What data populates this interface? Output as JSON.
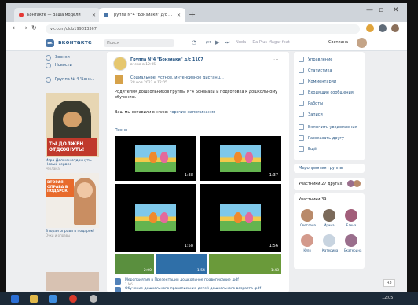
{
  "browser": {
    "tabs": [
      {
        "title": "Контакте — Ваша модели",
        "active": false,
        "favicon_color": "#e53935"
      },
      {
        "title": "Группа N°4 \"Бонзиаки\" д/с 1107",
        "active": true,
        "favicon_color": "#4a76a8"
      }
    ],
    "new_tab": "+",
    "address": "vk.com/club199013367",
    "window_controls": [
      "—",
      "▫",
      "✕"
    ]
  },
  "vk": {
    "logo_letter": "вк",
    "brand": "вконтакте",
    "search_placeholder": "Поиск",
    "player_text": "Nuda — Da Plus Magar feat",
    "user_name": "Светлана",
    "accent": "#4a76a8"
  },
  "leftnav": {
    "items": [
      "Звонки",
      "Новости",
      "Группа № 4 'Бонз..."
    ]
  },
  "ads": [
    {
      "title": "ТЫ ДОЛЖЕН ОТДОХНУТЬ!",
      "caption": "Игра Должен отдохнуть. Новый сервис",
      "sub": "Реклама"
    },
    {
      "title": "ВТОРАЯ ОПРАВА В ПОДАРОК",
      "caption": "Вторая оправа в подарок!",
      "sub": "Очки и оправы"
    }
  ],
  "post": {
    "group_name": "Группа N°4 \"Бонзиаки\" д/с 1107",
    "date": "вчера в 12:05",
    "more": "···",
    "sub_author": "Социальное, устное, интенсивное дистанц...",
    "sub_date": "28 ноя 2022 в 12:05",
    "text": "Родителям дошкольников группы N°4 Бонзиаки и подготовка к дошкольному обучению.",
    "link_prefix": "Ваш мы вставили в ниже:",
    "link_text": "горячие напоминания",
    "music_label": "Песня",
    "videos": [
      {
        "duration": "1:38"
      },
      {
        "duration": "1:37"
      },
      {
        "duration": "1:58"
      },
      {
        "duration": "1:56"
      }
    ],
    "strip": [
      {
        "duration": "2:00"
      },
      {
        "duration": "1:54"
      },
      {
        "duration": "1:48"
      }
    ],
    "docs": [
      {
        "name": "Мероприятия в Презентация дошкольное правописание .pdf",
        "size": "1 Мб"
      },
      {
        "name": "Обучение дошкольного правописания детей дошкольного возраста .pdf",
        "size": "1 Мб"
      }
    ]
  },
  "rightmenu": {
    "items": [
      "Управление",
      "Статистика",
      "Комментарии",
      "Входящие сообщения",
      "Работы",
      "Записи",
      "Включить уведомления",
      "Рассказать другу",
      "Ещё"
    ],
    "box2": "Мероприятия группы",
    "box3": "Участники 27 других",
    "members_title": "Участники 39",
    "members": [
      {
        "name": "Светлана",
        "color": "#b98a6a"
      },
      {
        "name": "Ирина",
        "color": "#7b6a5a"
      },
      {
        "name": "Елена",
        "color": "#a25e7a"
      },
      {
        "name": "Юля",
        "color": "#d39a8c"
      },
      {
        "name": "Катерина",
        "color": "#c8d4e0"
      },
      {
        "name": "Екатерина",
        "color": "#9a6e8c"
      }
    ]
  },
  "zoom": "ЧЗ",
  "taskbar": {
    "icons": [
      "start",
      "explorer",
      "chrome",
      "yandex",
      "other"
    ],
    "clock": "12:05"
  }
}
